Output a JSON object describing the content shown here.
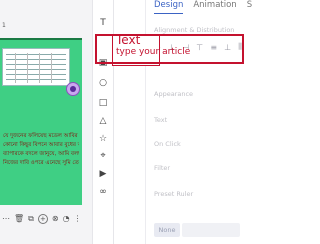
{
  "canvas": {
    "toolbar_number": "1",
    "bengali_lines": [
      "যে দুজনের ফলিয়েছ মডেল আবির",
      "কোনো কিছুর বিপনে আবার বুধের আসিয়ে",
      "ব্যাপারকে বদলে জানুযে, আমি বলছ কথা,",
      "নিজের দাবি ওপরে এনেছে সুমি তোমার বাকিতে"
    ]
  },
  "bottom_toolbar": {
    "add_label": "+",
    "icons": [
      "ellipsis-icon",
      "trash-icon",
      "copy-icon",
      "add-icon",
      "delete-icon",
      "lock-icon",
      "more-icon"
    ]
  },
  "side_toolbar": {
    "tools": [
      {
        "name": "text-tool-icon",
        "glyph": "T"
      },
      {
        "name": "image-tool-icon",
        "glyph": "▣"
      },
      {
        "name": "circle-tool-icon",
        "glyph": "○"
      },
      {
        "name": "square-tool-icon",
        "glyph": "□"
      },
      {
        "name": "triangle-tool-icon",
        "glyph": "△"
      },
      {
        "name": "star-tool-icon",
        "glyph": "☆"
      },
      {
        "name": "location-tool-icon",
        "glyph": "⌖"
      },
      {
        "name": "video-tool-icon",
        "glyph": "▶"
      },
      {
        "name": "link-tool-icon",
        "glyph": "∞"
      }
    ]
  },
  "callout": {
    "title": "Text",
    "subtitle": "type your article"
  },
  "panel": {
    "tabs": [
      "Design",
      "Animation",
      "S"
    ],
    "active_tab": "Design",
    "sections": {
      "alignment": "Alignment & Distribution",
      "appearance": "Appearance",
      "text": "Text",
      "on_click": "On Click",
      "filter": "Filter",
      "preset_ruler": "Preset Ruler"
    },
    "none_label": "None",
    "accent_color": "#3b63c4",
    "highlight_color": "#c4122f"
  }
}
